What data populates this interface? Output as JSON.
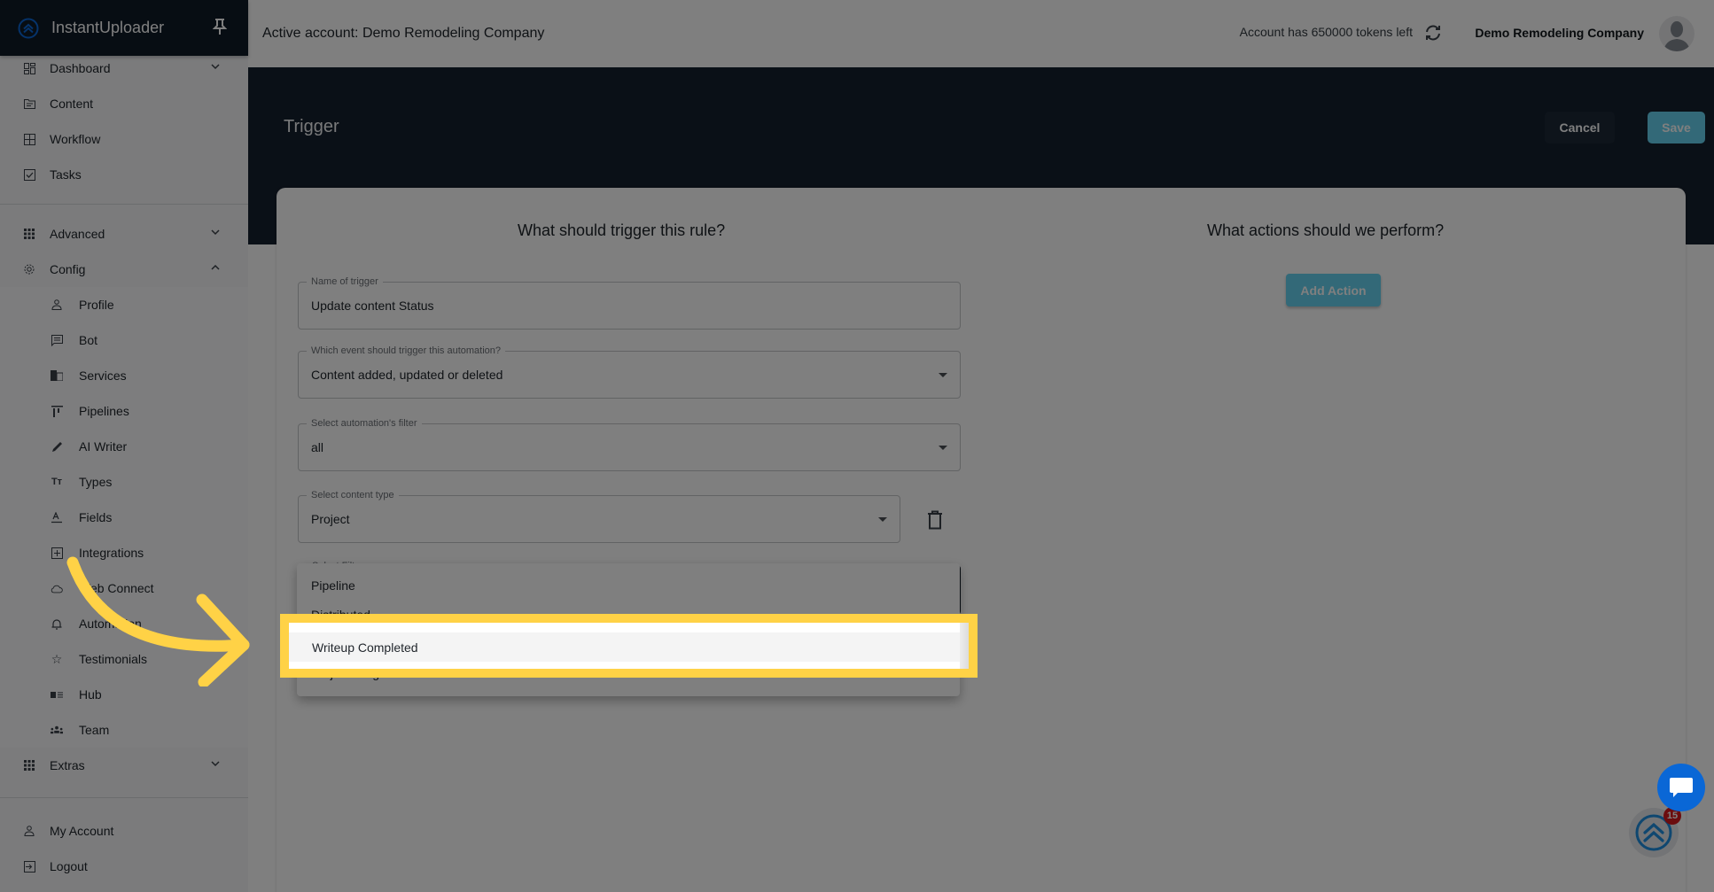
{
  "app": {
    "name": "InstantUploader",
    "brand_color": "#0a67d6",
    "logo_icon": "double-chevron-up-circle-icon",
    "pin_icon": "pin-icon"
  },
  "sidebar": {
    "top_items": [
      {
        "label": "Dashboard",
        "icon": "dashboard-icon",
        "expandable": true
      },
      {
        "label": "Content",
        "icon": "folder-icon"
      },
      {
        "label": "Workflow",
        "icon": "grid-icon"
      },
      {
        "label": "Tasks",
        "icon": "checkbox-icon"
      }
    ],
    "groups": [
      {
        "label": "Advanced",
        "icon": "apps-icon",
        "expanded": false
      },
      {
        "label": "Config",
        "icon": "gear-icon",
        "expanded": true
      }
    ],
    "config_items": [
      {
        "label": "Profile",
        "icon": "user-icon"
      },
      {
        "label": "Bot",
        "icon": "chat-box-icon"
      },
      {
        "label": "Services",
        "icon": "building-icon"
      },
      {
        "label": "Pipelines",
        "icon": "pipeline-icon"
      },
      {
        "label": "AI Writer",
        "icon": "pencil-icon"
      },
      {
        "label": "Types",
        "icon": "text-type-icon"
      },
      {
        "label": "Fields",
        "icon": "field-icon"
      },
      {
        "label": "Integrations",
        "icon": "plus-box-icon"
      },
      {
        "label": "Web Connect",
        "icon": "cloud-icon"
      },
      {
        "label": "Automation",
        "icon": "bell-icon"
      },
      {
        "label": "Testimonials",
        "icon": "star-icon"
      },
      {
        "label": "Hub",
        "icon": "card-list-icon"
      },
      {
        "label": "Team",
        "icon": "team-icon"
      }
    ],
    "extras": {
      "label": "Extras",
      "icon": "apps-icon"
    },
    "bottom_items": [
      {
        "label": "My Account",
        "icon": "user-icon"
      },
      {
        "label": "Logout",
        "icon": "logout-icon"
      }
    ]
  },
  "header": {
    "active_account": "Active account: Demo Remodeling Company",
    "tokens": "Account has 650000 tokens left",
    "company": "Demo Remodeling Company"
  },
  "page": {
    "title": "Trigger",
    "cancel_label": "Cancel",
    "save_label": "Save",
    "accent_color": "#66d3f1"
  },
  "trigger": {
    "heading": "What should trigger this rule?",
    "fields": {
      "name": {
        "label": "Name of trigger",
        "value": "Update content Status"
      },
      "event": {
        "label": "Which event should trigger this automation?",
        "value": "Content added, updated or deleted"
      },
      "filter": {
        "label": "Select automation's filter",
        "value": "all"
      },
      "content_type": {
        "label": "Select content type",
        "value": "Project"
      },
      "select_filter": {
        "label": "Select Filter",
        "value": ""
      }
    },
    "filter_options": [
      "Pipeline",
      "Distributed",
      "Writeup Completed",
      "Project Progress"
    ],
    "selected_option": "Writeup Completed"
  },
  "actions": {
    "heading": "What actions should we perform?",
    "add_label": "Add Action"
  },
  "widgets": {
    "notification_count": "15",
    "highlight_color": "#ffd246"
  }
}
